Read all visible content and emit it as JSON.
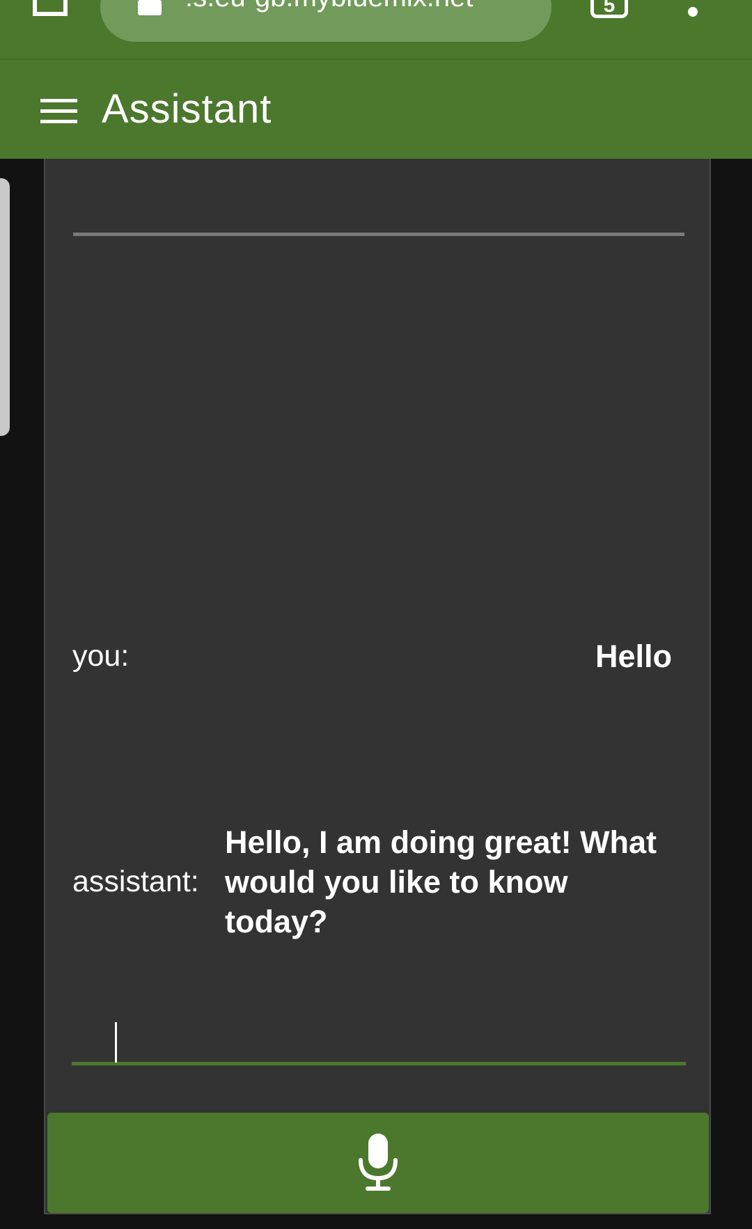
{
  "browser": {
    "url": ":s.eu-gb.mybluemix.net",
    "tab_count": "5"
  },
  "header": {
    "title": "Assistant"
  },
  "conversation": [
    {
      "speaker": "you:",
      "text": "Hello"
    },
    {
      "speaker": "assistant:",
      "text": "Hello, I am doing great! What would you like to know today?"
    }
  ],
  "input": {
    "value": "",
    "placeholder": ""
  },
  "colors": {
    "brand": "#4b782d",
    "panel": "#333333",
    "background": "#121212"
  },
  "icons": {
    "menu": "hamburger-icon",
    "voice": "microphone-icon"
  }
}
